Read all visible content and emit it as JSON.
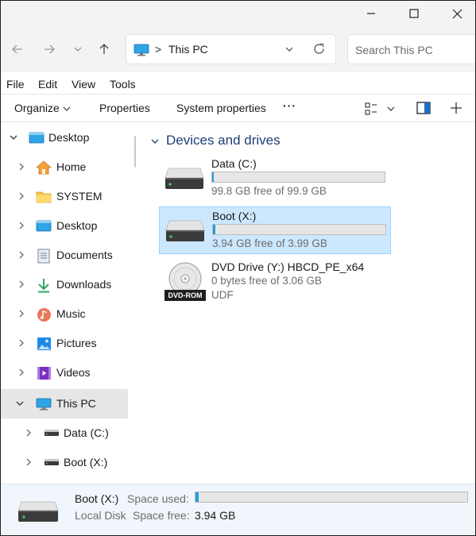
{
  "window": {
    "controls": [
      "minimize-icon",
      "maximize-icon",
      "close-icon"
    ]
  },
  "address": {
    "icons": [
      "back-arrow-icon",
      "forward-arrow-icon",
      "recent-locations-chevron-icon",
      "up-arrow-icon",
      "this-pc-icon",
      "address-dropdown-icon",
      "refresh-icon"
    ],
    "separator": ">",
    "path": "This PC"
  },
  "search": {
    "placeholder": "Search This PC"
  },
  "menu": {
    "file": "File",
    "edit": "Edit",
    "view": "View",
    "tools": "Tools"
  },
  "commandbar": {
    "organize": "Organize",
    "properties": "Properties",
    "system_properties": "System properties",
    "more": "···",
    "icons": [
      "organize-chevron-icon",
      "view-options-icon",
      "view-chevron-icon",
      "preview-pane-icon",
      "add-icon"
    ]
  },
  "nav": {
    "items": [
      {
        "label": "Desktop",
        "icon": "desktop-icon",
        "expanded": true
      },
      {
        "label": "Home",
        "icon": "home-icon"
      },
      {
        "label": "SYSTEM",
        "icon": "folder-icon"
      },
      {
        "label": "Desktop",
        "icon": "desktop-icon"
      },
      {
        "label": "Documents",
        "icon": "documents-icon"
      },
      {
        "label": "Downloads",
        "icon": "downloads-icon"
      },
      {
        "label": "Music",
        "icon": "music-icon"
      },
      {
        "label": "Pictures",
        "icon": "pictures-icon"
      },
      {
        "label": "Videos",
        "icon": "videos-icon"
      },
      {
        "label": "This PC",
        "icon": "this-pc-icon",
        "expanded": true,
        "selected": true
      },
      {
        "label": "Data (C:)",
        "icon": "drive-icon"
      },
      {
        "label": "Boot (X:)",
        "icon": "drive-icon"
      }
    ]
  },
  "content": {
    "group_title": "Devices and drives",
    "drives": [
      {
        "name": "Data (C:)",
        "free_text": "99.8 GB free of 99.9 GB",
        "used_fraction": 0.001,
        "selected": false
      },
      {
        "name": "Boot (X:)",
        "free_text": "3.94 GB free of 3.99 GB",
        "used_fraction": 0.0125,
        "selected": true
      }
    ],
    "dvd": {
      "name": "DVD Drive (Y:) HBCD_PE_x64",
      "free_text": "0 bytes free of 3.06 GB",
      "filesystem": "UDF",
      "badge": "DVD-ROM"
    }
  },
  "details": {
    "name": "Boot (X:)",
    "type": "Local Disk",
    "space_used_label": "Space used:",
    "space_free_label": "Space free:",
    "space_free_value": "3.94 GB",
    "used_fraction": 0.0125
  },
  "colors": {
    "accent": "#26a0da",
    "selection": "#cce8ff",
    "selection_border": "#99d1ff",
    "group_title": "#1d3f7a"
  }
}
